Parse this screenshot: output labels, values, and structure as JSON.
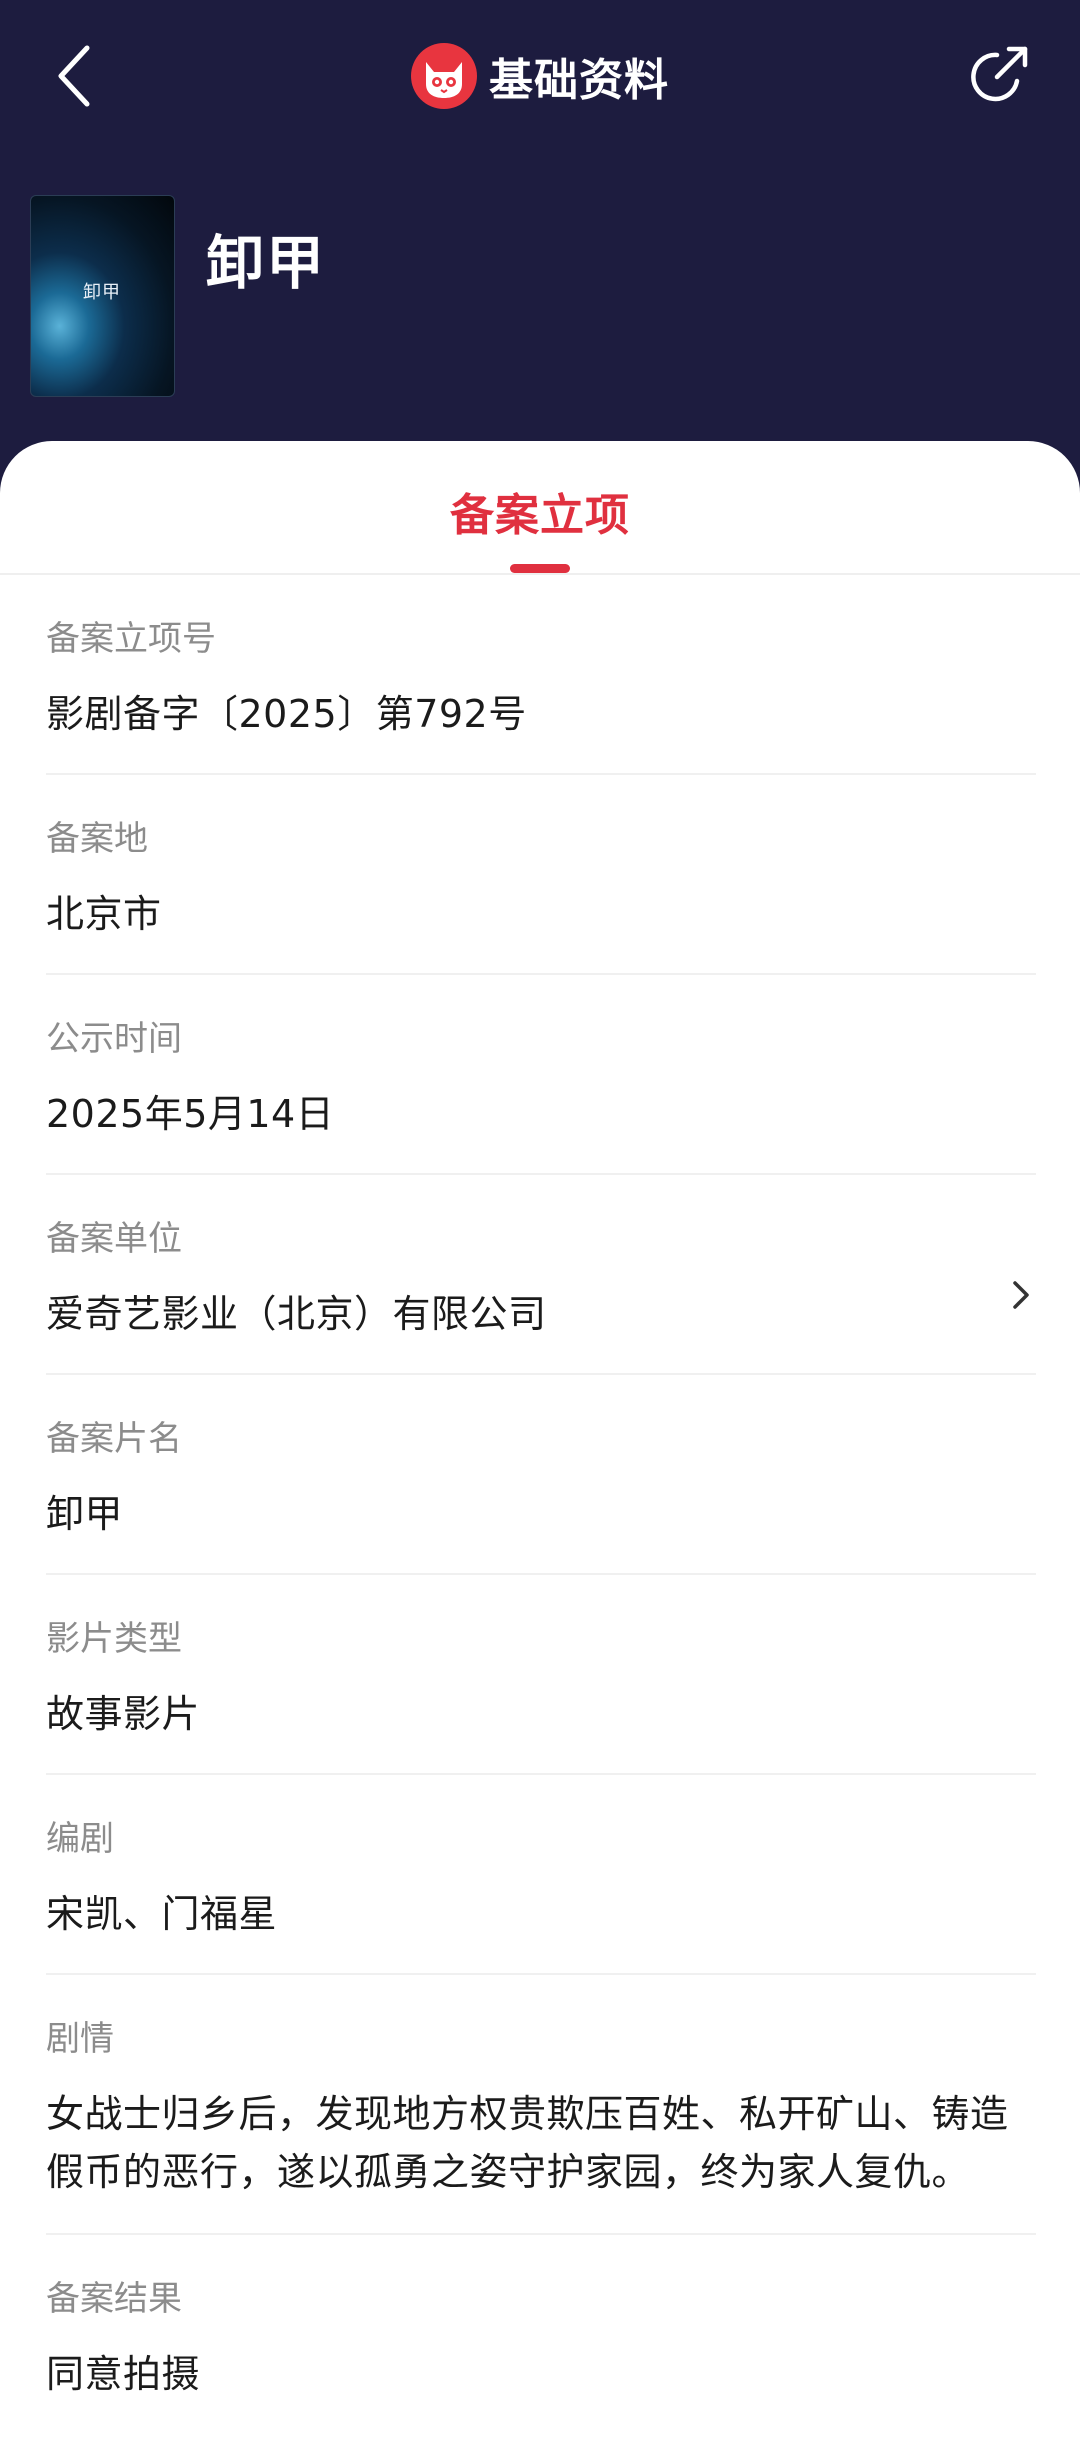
{
  "header": {
    "title": "基础资料",
    "back_icon": "back-arrow-icon",
    "share_icon": "share-icon",
    "logo_icon": "cat-logo-icon",
    "background": "#1d1c3f"
  },
  "movie": {
    "title": "卸甲",
    "poster_text": "卸甲"
  },
  "tabs": [
    {
      "label": "备案立项",
      "active": true
    }
  ],
  "accent_color": "#e0303f",
  "fields": [
    {
      "label": "备案立项号",
      "value": "影剧备字〔2025〕第792号"
    },
    {
      "label": "备案地",
      "value": "北京市"
    },
    {
      "label": "公示时间",
      "value": "2025年5月14日"
    },
    {
      "label": "备案单位",
      "value": "爱奇艺影业（北京）有限公司",
      "link": true
    },
    {
      "label": "备案片名",
      "value": "卸甲"
    },
    {
      "label": "影片类型",
      "value": "故事影片"
    },
    {
      "label": "编剧",
      "value": "宋凯、门福星"
    },
    {
      "label": "剧情",
      "value": "女战士归乡后，发现地方权贵欺压百姓、私开矿山、铸造假币的恶行，遂以孤勇之姿守护家园，终为家人复仇。"
    },
    {
      "label": "备案结果",
      "value": "同意拍摄"
    }
  ]
}
